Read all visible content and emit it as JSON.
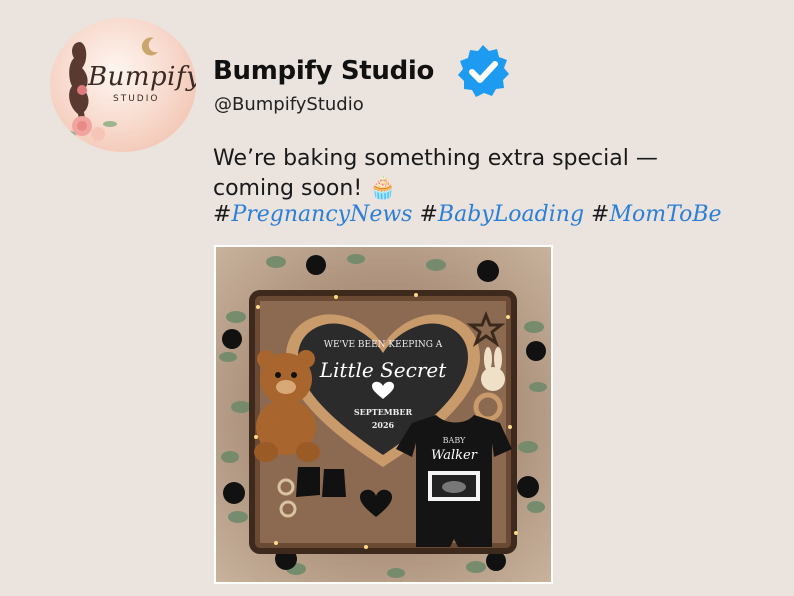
{
  "account": {
    "logo_text": "Bumpify",
    "logo_sub": "STUDIO",
    "name": "Bumpify Studio",
    "handle": "@BumpifyStudio",
    "verified_icon": "verified-badge-icon",
    "verified_color": "#1d9bf0"
  },
  "post": {
    "text_line1": "We’re baking something extra special —",
    "text_line2": "coming soon! 🧁",
    "hashtags": [
      "PregnancyNews",
      "BabyLoading",
      "MomToBe"
    ]
  },
  "photo": {
    "sign_line1": "WE'VE BEEN KEEPING A",
    "sign_line2": "Little Secret",
    "sign_month": "SEPTEMBER",
    "sign_year": "2026",
    "onesie_line1": "BABY",
    "onesie_line2": "Walker"
  }
}
